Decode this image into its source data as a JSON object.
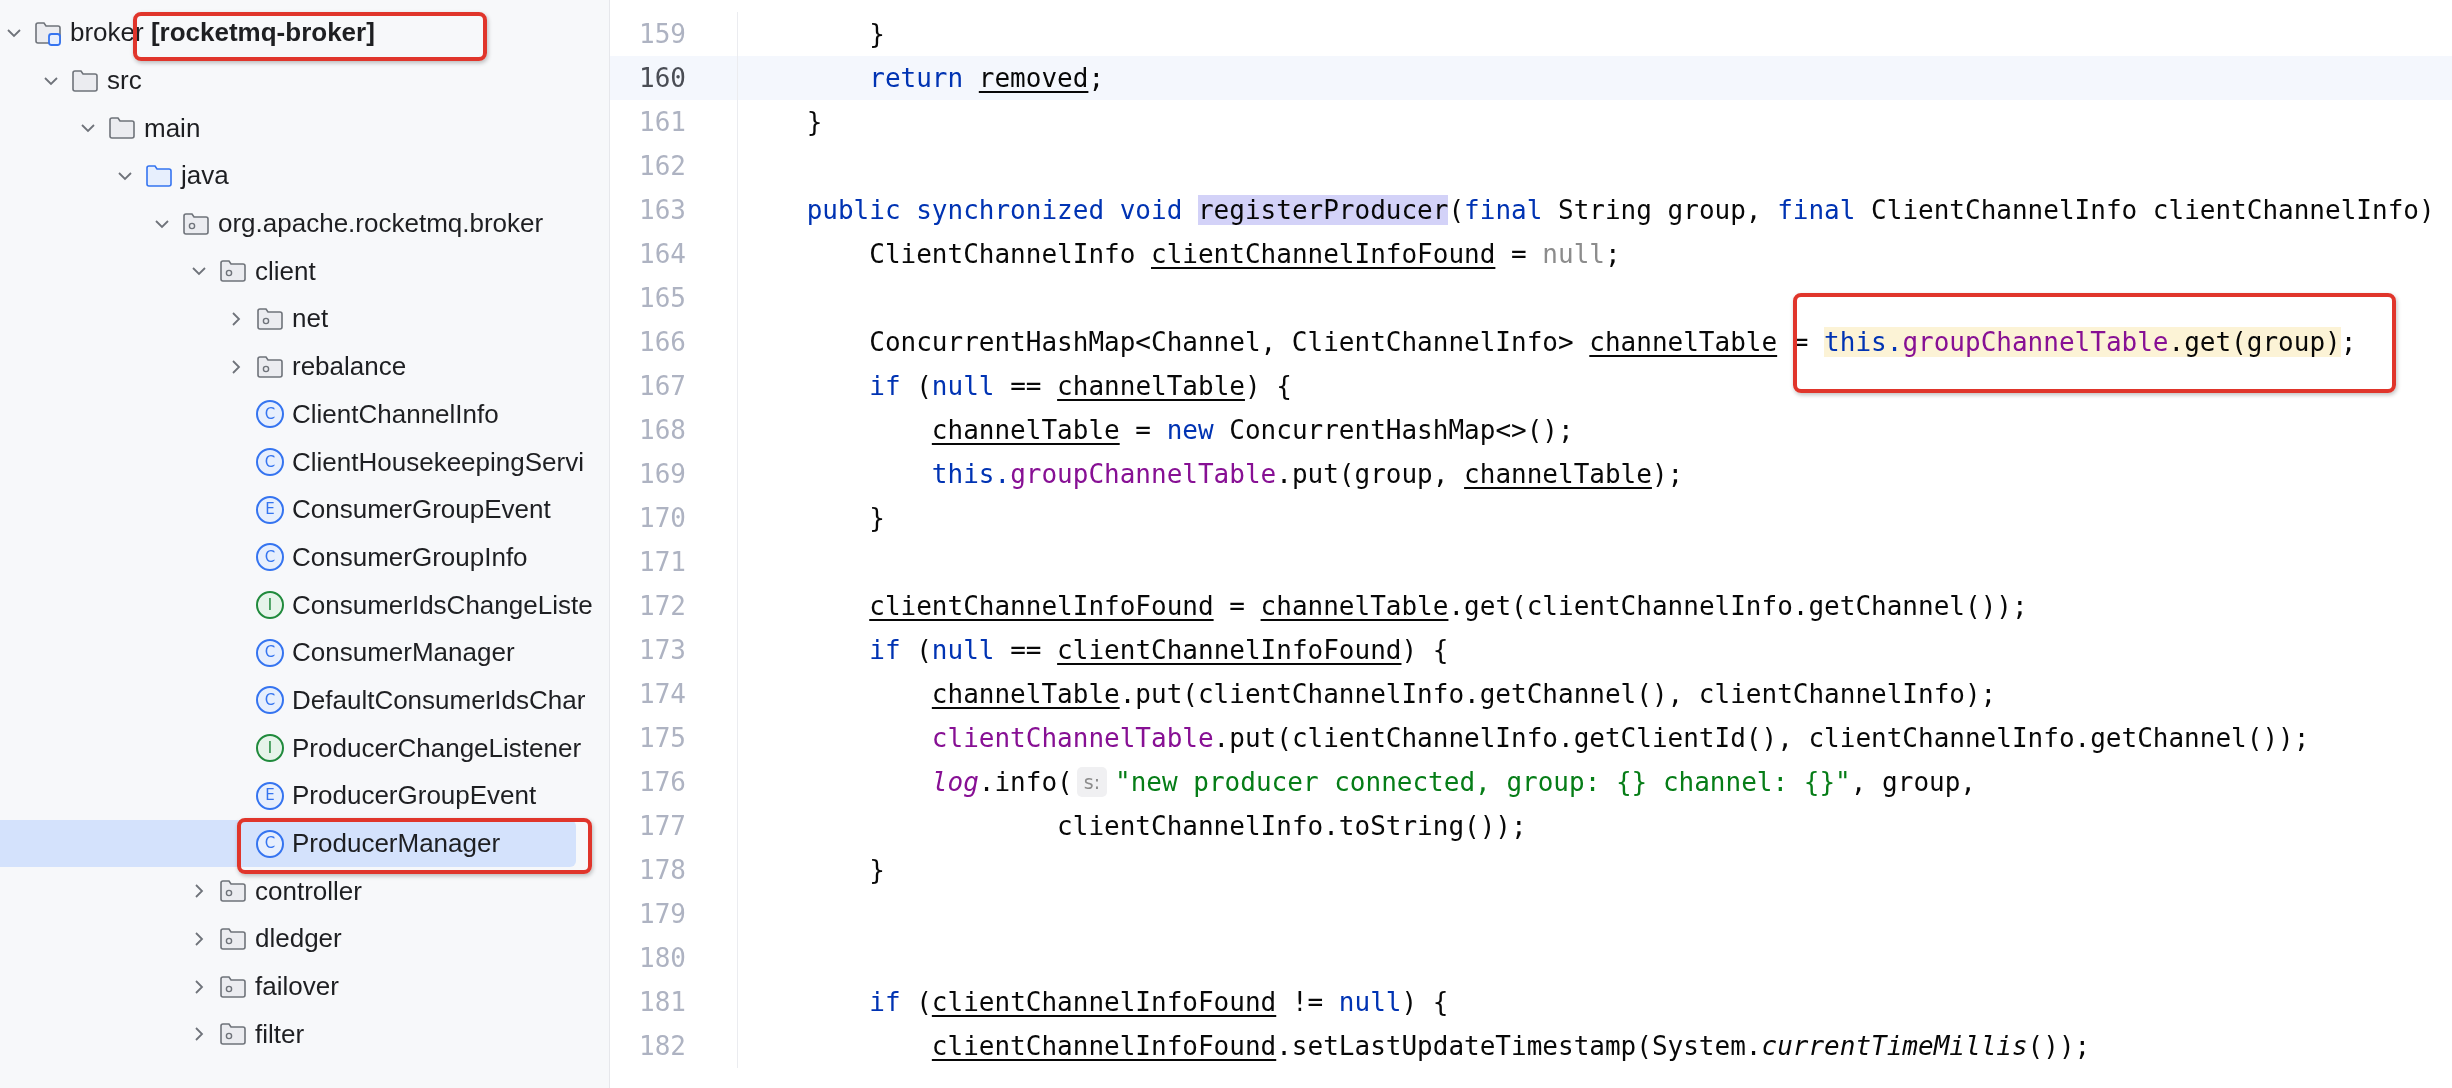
{
  "project_tree": [
    {
      "label": "broker **[rocketmq-broker]**",
      "kind": "module",
      "expanded": true,
      "selected": false,
      "annotated": true,
      "children": [
        {
          "label": "src",
          "kind": "folder",
          "expanded": true,
          "selected": false,
          "annotated": false,
          "children": [
            {
              "label": "main",
              "kind": "folder",
              "expanded": true,
              "selected": false,
              "annotated": false,
              "children": [
                {
                  "label": "java",
                  "kind": "source-folder",
                  "expanded": true,
                  "selected": false,
                  "annotated": false,
                  "children": [
                    {
                      "label": "org.apache.rocketmq.broker",
                      "kind": "package",
                      "expanded": true,
                      "selected": false,
                      "annotated": false,
                      "children": [
                        {
                          "label": "client",
                          "kind": "package",
                          "expanded": true,
                          "selected": false,
                          "annotated": false,
                          "children": [
                            {
                              "label": "net",
                              "kind": "package",
                              "expanded": false,
                              "selected": false,
                              "annotated": false
                            },
                            {
                              "label": "rebalance",
                              "kind": "package",
                              "expanded": false,
                              "selected": false,
                              "annotated": false
                            },
                            {
                              "label": "ClientChannelInfo",
                              "kind": "class",
                              "badge": "C",
                              "selected": false,
                              "annotated": false
                            },
                            {
                              "label": "ClientHousekeepingServi",
                              "kind": "class",
                              "badge": "C",
                              "selected": false,
                              "annotated": false
                            },
                            {
                              "label": "ConsumerGroupEvent",
                              "kind": "enum",
                              "badge": "E",
                              "selected": false,
                              "annotated": false
                            },
                            {
                              "label": "ConsumerGroupInfo",
                              "kind": "class",
                              "badge": "C",
                              "selected": false,
                              "annotated": false
                            },
                            {
                              "label": "ConsumerIdsChangeListe",
                              "kind": "interface",
                              "badge": "I",
                              "selected": false,
                              "annotated": false
                            },
                            {
                              "label": "ConsumerManager",
                              "kind": "class",
                              "badge": "C",
                              "selected": false,
                              "annotated": false
                            },
                            {
                              "label": "DefaultConsumerIdsChar",
                              "kind": "class",
                              "badge": "C",
                              "selected": false,
                              "annotated": false
                            },
                            {
                              "label": "ProducerChangeListener",
                              "kind": "interface",
                              "badge": "I",
                              "selected": false,
                              "annotated": false
                            },
                            {
                              "label": "ProducerGroupEvent",
                              "kind": "enum",
                              "badge": "E",
                              "selected": false,
                              "annotated": false
                            },
                            {
                              "label": "ProducerManager",
                              "kind": "class",
                              "badge": "C",
                              "selected": true,
                              "annotated": true
                            }
                          ]
                        },
                        {
                          "label": "controller",
                          "kind": "package",
                          "expanded": false,
                          "selected": false,
                          "annotated": false
                        },
                        {
                          "label": "dledger",
                          "kind": "package",
                          "expanded": false,
                          "selected": false,
                          "annotated": false
                        },
                        {
                          "label": "failover",
                          "kind": "package",
                          "expanded": false,
                          "selected": false,
                          "annotated": false
                        },
                        {
                          "label": "filter",
                          "kind": "package",
                          "expanded": false,
                          "selected": false,
                          "annotated": false
                        }
                      ]
                    }
                  ]
                }
              ]
            }
          ]
        }
      ]
    }
  ],
  "editor": {
    "lines": [
      {
        "number": "159",
        "current": false,
        "segments": [
          {
            "kind": "code",
            "annotated": false,
            "tokens": [
              {
                "text": "        }",
                "kind": "plain"
              }
            ]
          }
        ]
      },
      {
        "number": "160",
        "current": true,
        "segments": [
          {
            "kind": "code",
            "annotated": false,
            "tokens": [
              {
                "text": "        return ",
                "kind": "keyword"
              },
              {
                "text": "removed",
                "kind": "variable"
              },
              {
                "text": ";",
                "kind": "plain"
              }
            ]
          }
        ]
      },
      {
        "number": "161",
        "current": false,
        "segments": [
          {
            "kind": "code",
            "annotated": false,
            "tokens": [
              {
                "text": "    }",
                "kind": "plain"
              }
            ]
          }
        ]
      },
      {
        "number": "162",
        "current": false
      },
      {
        "number": "163",
        "current": false,
        "segments": [
          {
            "kind": "code",
            "annotated": false,
            "tokens": [
              {
                "text": "    public synchronized void ",
                "kind": "keyword"
              },
              {
                "text": "registerProducer",
                "kind": "declaration"
              },
              {
                "text": "(",
                "kind": "plain"
              },
              {
                "text": "final ",
                "kind": "keyword"
              },
              {
                "text": "String group, ",
                "kind": "plain"
              },
              {
                "text": "final ",
                "kind": "keyword"
              },
              {
                "text": "ClientChannelInfo clientChannelInfo)",
                "kind": "plain"
              }
            ]
          }
        ]
      },
      {
        "number": "164",
        "current": false,
        "segments": [
          {
            "kind": "code",
            "annotated": false,
            "tokens": [
              {
                "text": "        ClientChannelInfo ",
                "kind": "plain"
              },
              {
                "text": "clientChannelInfoFound",
                "kind": "variable"
              },
              {
                "text": " = ",
                "kind": "plain"
              },
              {
                "text": "null",
                "kind": "unused"
              },
              {
                "text": ";",
                "kind": "plain"
              }
            ]
          }
        ]
      },
      {
        "number": "165",
        "current": false
      },
      {
        "number": "166",
        "current": false,
        "segments": [
          {
            "kind": "code",
            "annotated": false,
            "tokens": [
              {
                "text": "        ConcurrentHashMap<Channel, ClientChannelInfo> ",
                "kind": "plain"
              },
              {
                "text": "channelTable",
                "kind": "variable"
              },
              {
                "text": " = ",
                "kind": "plain"
              }
            ]
          },
          {
            "kind": "code",
            "annotated": true,
            "tokens": [
              {
                "text": "this.",
                "kind": "keyword"
              },
              {
                "text": "groupChannelTable",
                "kind": "field"
              },
              {
                "text": ".get(group)",
                "kind": "plain"
              }
            ]
          },
          {
            "kind": "code",
            "annotated": false,
            "tokens": [
              {
                "text": ";",
                "kind": "plain"
              }
            ]
          }
        ]
      },
      {
        "number": "167",
        "current": false,
        "segments": [
          {
            "kind": "code",
            "annotated": false,
            "tokens": [
              {
                "text": "        if ",
                "kind": "keyword"
              },
              {
                "text": "(",
                "kind": "plain"
              },
              {
                "text": "null ",
                "kind": "keyword"
              },
              {
                "text": "== ",
                "kind": "plain"
              },
              {
                "text": "channelTable",
                "kind": "variable"
              },
              {
                "text": ") {",
                "kind": "plain"
              }
            ]
          }
        ]
      },
      {
        "number": "168",
        "current": false,
        "segments": [
          {
            "kind": "code",
            "annotated": false,
            "tokens": [
              {
                "text": "            channelTable",
                "kind": "variable"
              },
              {
                "text": " = ",
                "kind": "plain"
              },
              {
                "text": "new ",
                "kind": "keyword"
              },
              {
                "text": "ConcurrentHashMap<>();",
                "kind": "plain"
              }
            ]
          }
        ]
      },
      {
        "number": "169",
        "current": false,
        "segments": [
          {
            "kind": "code",
            "annotated": false,
            "tokens": [
              {
                "text": "            this.",
                "kind": "keyword"
              },
              {
                "text": "groupChannelTable",
                "kind": "field"
              },
              {
                "text": ".put(group, ",
                "kind": "plain"
              },
              {
                "text": "channelTable",
                "kind": "variable"
              },
              {
                "text": ");",
                "kind": "plain"
              }
            ]
          }
        ]
      },
      {
        "number": "170",
        "current": false,
        "segments": [
          {
            "kind": "code",
            "annotated": false,
            "tokens": [
              {
                "text": "        }",
                "kind": "plain"
              }
            ]
          }
        ]
      },
      {
        "number": "171",
        "current": false
      },
      {
        "number": "172",
        "current": false,
        "segments": [
          {
            "kind": "code",
            "annotated": false,
            "tokens": [
              {
                "text": "        clientChannelInfoFound",
                "kind": "variable"
              },
              {
                "text": " = ",
                "kind": "plain"
              },
              {
                "text": "channelTable",
                "kind": "variable"
              },
              {
                "text": ".get(clientChannelInfo.getChannel());",
                "kind": "plain"
              }
            ]
          }
        ]
      },
      {
        "number": "173",
        "current": false,
        "segments": [
          {
            "kind": "code",
            "annotated": false,
            "tokens": [
              {
                "text": "        if ",
                "kind": "keyword"
              },
              {
                "text": "(",
                "kind": "plain"
              },
              {
                "text": "null ",
                "kind": "keyword"
              },
              {
                "text": "== ",
                "kind": "plain"
              },
              {
                "text": "clientChannelInfoFound",
                "kind": "variable"
              },
              {
                "text": ") {",
                "kind": "plain"
              }
            ]
          }
        ]
      },
      {
        "number": "174",
        "current": false,
        "segments": [
          {
            "kind": "code",
            "annotated": false,
            "tokens": [
              {
                "text": "            channelTable",
                "kind": "variable"
              },
              {
                "text": ".put(clientChannelInfo.getChannel(), clientChannelInfo);",
                "kind": "plain"
              }
            ]
          }
        ]
      },
      {
        "number": "175",
        "current": false,
        "segments": [
          {
            "kind": "code",
            "annotated": false,
            "tokens": [
              {
                "text": "            clientChannelTable",
                "kind": "field"
              },
              {
                "text": ".put(clientChannelInfo.getClientId(), clientChannelInfo.getChannel());",
                "kind": "plain"
              }
            ]
          }
        ]
      },
      {
        "number": "176",
        "current": false,
        "segments": [
          {
            "kind": "code",
            "annotated": false,
            "tokens": [
              {
                "text": "            log",
                "kind": "static-field"
              },
              {
                "text": ".info(",
                "kind": "plain"
              }
            ]
          },
          {
            "kind": "hint",
            "text": "s:"
          },
          {
            "kind": "code",
            "annotated": false,
            "tokens": [
              {
                "text": "\"new producer connected, group: {} channel: {}\"",
                "kind": "string"
              },
              {
                "text": ", group,",
                "kind": "plain"
              }
            ]
          }
        ]
      },
      {
        "number": "177",
        "current": false,
        "segments": [
          {
            "kind": "code",
            "annotated": false,
            "tokens": [
              {
                "text": "                    clientChannelInfo.toString());",
                "kind": "plain"
              }
            ]
          }
        ]
      },
      {
        "number": "178",
        "current": false,
        "segments": [
          {
            "kind": "code",
            "annotated": false,
            "tokens": [
              {
                "text": "        }",
                "kind": "plain"
              }
            ]
          }
        ]
      },
      {
        "number": "179",
        "current": false
      },
      {
        "number": "180",
        "current": false
      },
      {
        "number": "181",
        "current": false,
        "segments": [
          {
            "kind": "code",
            "annotated": false,
            "tokens": [
              {
                "text": "        if ",
                "kind": "keyword"
              },
              {
                "text": "(",
                "kind": "plain"
              },
              {
                "text": "clientChannelInfoFound",
                "kind": "variable"
              },
              {
                "text": " != ",
                "kind": "plain"
              },
              {
                "text": "null",
                "kind": "keyword"
              },
              {
                "text": ") {",
                "kind": "plain"
              }
            ]
          }
        ]
      },
      {
        "number": "182",
        "current": false,
        "segments": [
          {
            "kind": "code",
            "annotated": false,
            "tokens": [
              {
                "text": "            clientChannelInfoFound",
                "kind": "variable"
              },
              {
                "text": ".setLastUpdateTimestamp(System.",
                "kind": "plain"
              },
              {
                "text": "currentTimeMillis",
                "kind": "static-method"
              },
              {
                "text": "());",
                "kind": "plain"
              }
            ]
          }
        ]
      }
    ]
  }
}
